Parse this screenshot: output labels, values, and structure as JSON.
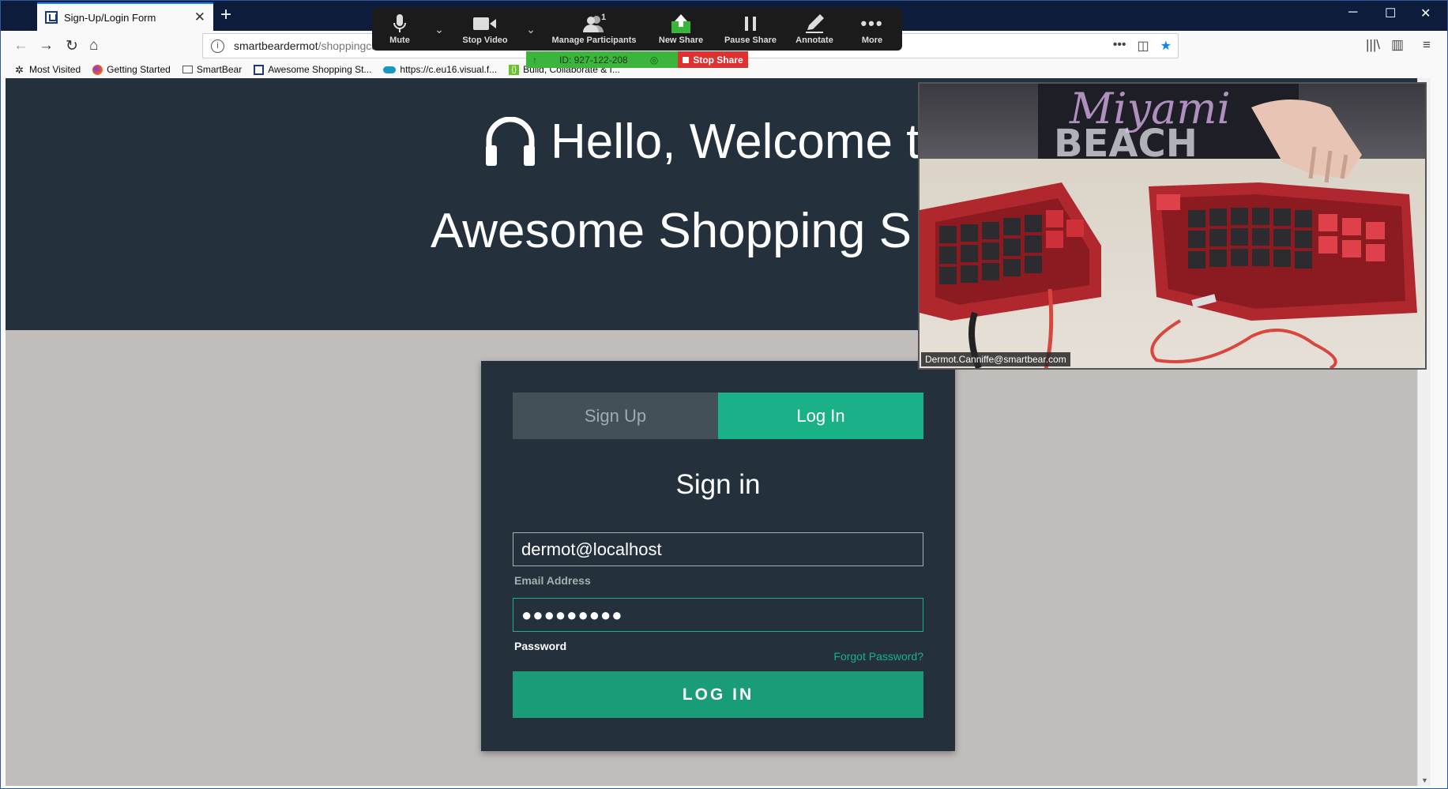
{
  "browser": {
    "tab_title": "Sign-Up/Login Form",
    "tab_close": "✕",
    "new_tab": "+",
    "url_host": "smartbeardermot",
    "url_path": "/shoppingca",
    "window_controls": {
      "minimize": "─",
      "maximize": "☐",
      "close": "✕"
    }
  },
  "bookmarks": [
    {
      "label": "Most Visited",
      "icon": "gear-icon"
    },
    {
      "label": "Getting Started",
      "icon": "firefox-icon"
    },
    {
      "label": "SmartBear",
      "icon": "folder-icon"
    },
    {
      "label": "Awesome Shopping St...",
      "icon": "site-icon"
    },
    {
      "label": "https://c.eu16.visual.f...",
      "icon": "cloud-icon"
    },
    {
      "label": "Build, Collaborate & I...",
      "icon": "bracket-icon"
    }
  ],
  "hero": {
    "line1": "Hello, Welcome t",
    "line2": "Awesome Shopping S"
  },
  "form": {
    "tab_signup": "Sign Up",
    "tab_login": "Log In",
    "heading": "Sign in",
    "email_value": "dermot@localhost",
    "email_label": "Email Address",
    "password_value": "●●●●●●●●●",
    "password_label": "Password",
    "forgot": "Forgot Password?",
    "submit": "LOG IN"
  },
  "zoom": {
    "mute": "Mute",
    "stop_video": "Stop Video",
    "manage_participants": "Manage Participants",
    "participant_count": "1",
    "new_share": "New Share",
    "pause_share": "Pause Share",
    "annotate": "Annotate",
    "more": "More",
    "meeting_id": "ID: 927-122-208",
    "stop_share": "Stop Share"
  },
  "webcam": {
    "caption": "Dermot.Canniffe@smartbear.com"
  },
  "colors": {
    "accent": "#1ab188",
    "hero_bg": "#24313c",
    "page_bg": "#c1bdbb",
    "stop_red": "#e03131",
    "share_green": "#3bb53b"
  }
}
